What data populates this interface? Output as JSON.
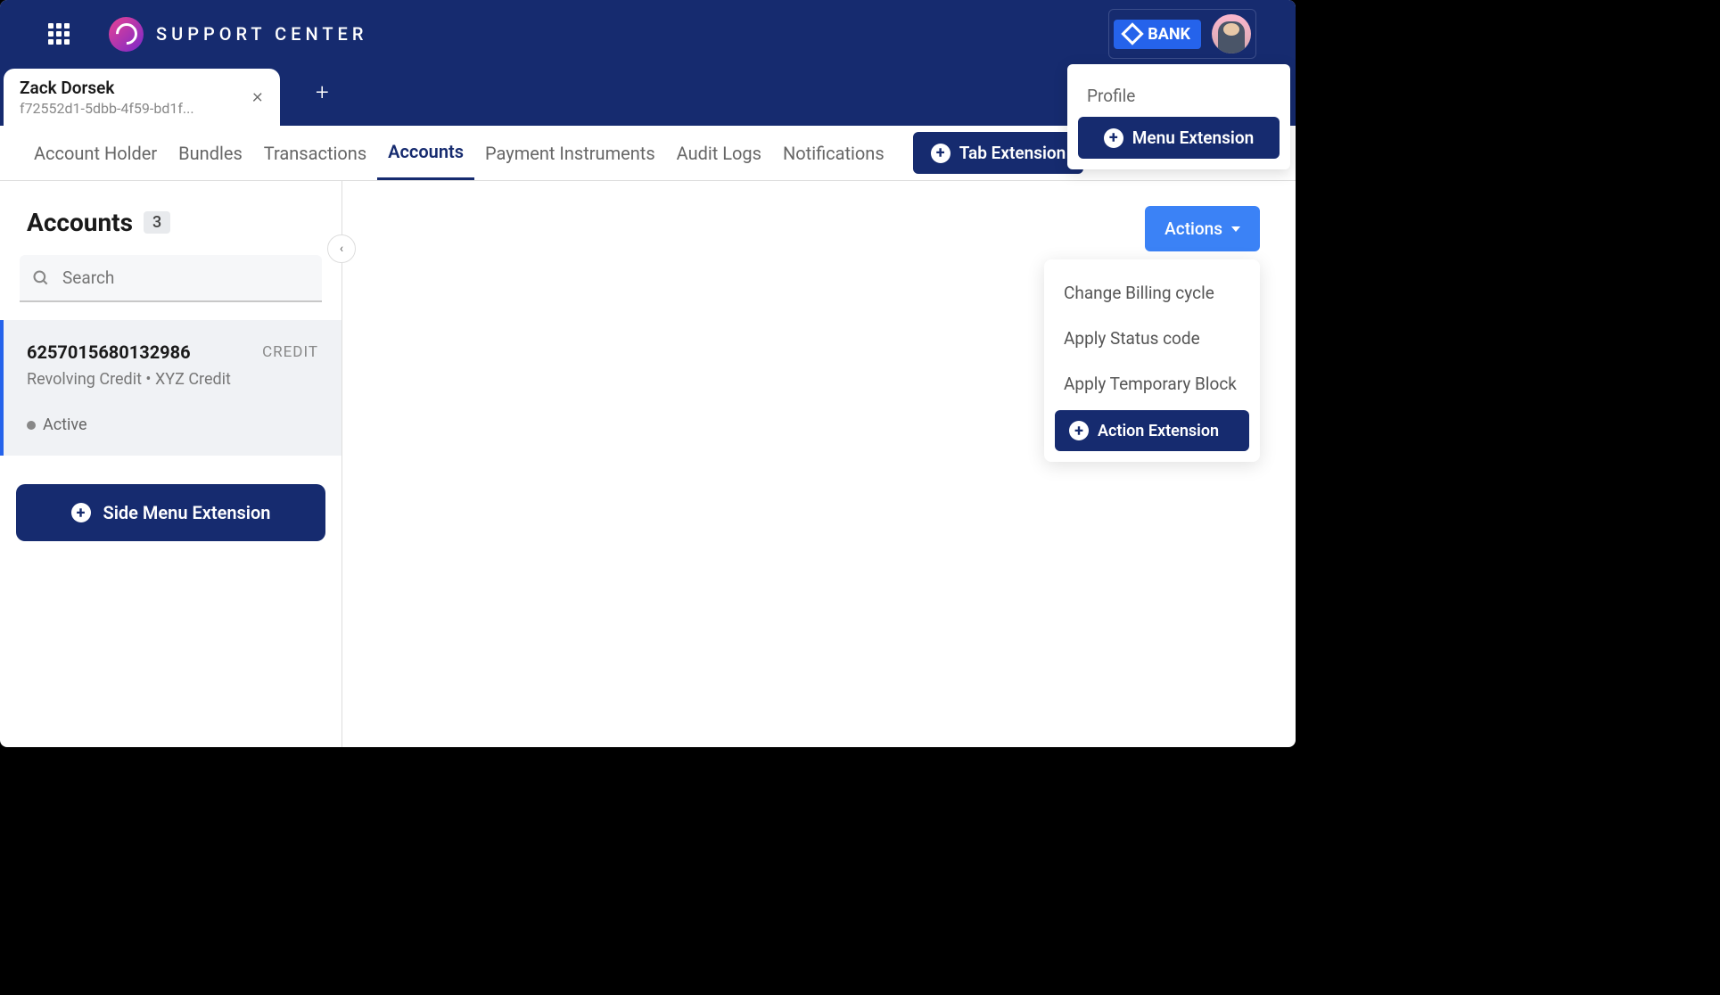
{
  "header": {
    "app_title": "SUPPORT CENTER",
    "bank_label": "BANK"
  },
  "profile_dropdown": {
    "label": "Profile",
    "menu_extension_label": "Menu Extension"
  },
  "tab": {
    "customer_name": "Zack Dorsek",
    "customer_id": "f72552d1-5dbb-4f59-bd1f..."
  },
  "nav": {
    "items": [
      "Account Holder",
      "Bundles",
      "Transactions",
      "Accounts",
      "Payment Instruments",
      "Audit Logs",
      "Notifications"
    ],
    "active_index": 3,
    "tab_extension_label": "Tab Extension"
  },
  "sidebar": {
    "title": "Accounts",
    "count": "3",
    "search_placeholder": "Search",
    "account": {
      "number": "6257015680132986",
      "type": "CREDIT",
      "description": "Revolving Credit • XYZ Credit",
      "status": "Active"
    },
    "side_menu_extension_label": "Side Menu Extension"
  },
  "actions": {
    "button_label": "Actions",
    "items": [
      "Change Billing cycle",
      "Apply Status code",
      "Apply Temporary Block"
    ],
    "action_extension_label": "Action Extension"
  }
}
